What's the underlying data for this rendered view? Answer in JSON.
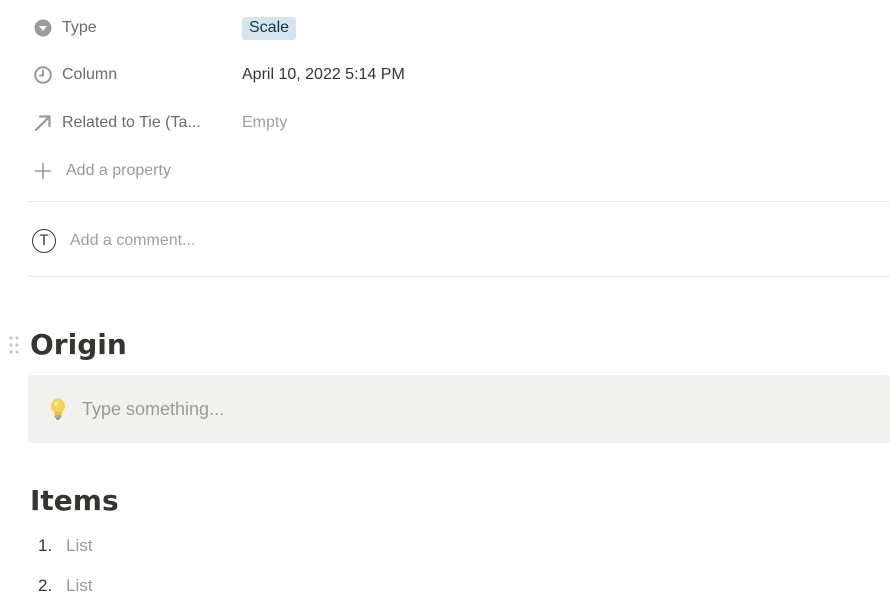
{
  "properties": [
    {
      "icon": "select-icon",
      "name": "Type",
      "value": "Scale"
    },
    {
      "icon": "clock-icon",
      "name": "Column",
      "value": "April 10, 2022 5:14 PM"
    },
    {
      "icon": "relation-arrow-icon",
      "name": "Related to Tie (Ta...",
      "value": "Empty"
    }
  ],
  "add_property_label": "Add a property",
  "comment": {
    "avatar_initial": "T",
    "placeholder": "Add a comment..."
  },
  "sections": {
    "origin_heading": "Origin",
    "callout_placeholder": "Type something...",
    "items_heading": "Items"
  },
  "list": [
    {
      "number": "1.",
      "text": "List"
    },
    {
      "number": "2.",
      "text": "List"
    }
  ],
  "colors": {
    "tag_background": "#d3e5ef",
    "callout_background": "#f1f1ef",
    "muted_text": "#9b9a97"
  }
}
